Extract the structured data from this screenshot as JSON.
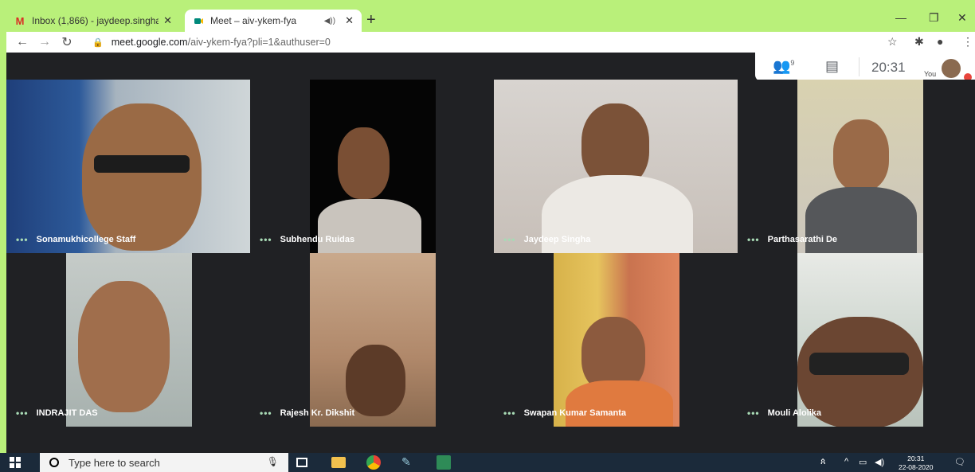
{
  "browser": {
    "tabs": [
      {
        "title": "Inbox (1,866) - jaydeep.singha@",
        "icon": "gmail-icon",
        "active": false
      },
      {
        "title": "Meet – aiv-ykem-fya",
        "icon": "meet-icon",
        "active": true
      }
    ],
    "url_host": "meet.google.com",
    "url_path": "/aiv-ykem-fya?pli=1&authuser=0"
  },
  "meet": {
    "people_count": "9",
    "clock": "20:31",
    "self_label": "You",
    "participants": [
      {
        "name": "Sonamukhicollege Staff"
      },
      {
        "name": "Subhendu Ruidas"
      },
      {
        "name": "Jaydeep Singha"
      },
      {
        "name": "Parthasarathi De"
      },
      {
        "name": "INDRAJIT DAS"
      },
      {
        "name": "Rajesh Kr. Dikshit"
      },
      {
        "name": "Swapan Kumar Samanta"
      },
      {
        "name": "Mouli Alolika"
      }
    ],
    "more_dots": "•••"
  },
  "taskbar": {
    "search_placeholder": "Type here to search",
    "time": "20:31",
    "date": "22-08-2020"
  },
  "colors": {
    "page_bg": "#b9f07a",
    "meet_bg": "#202124",
    "taskbar": "#1b2a3a"
  }
}
